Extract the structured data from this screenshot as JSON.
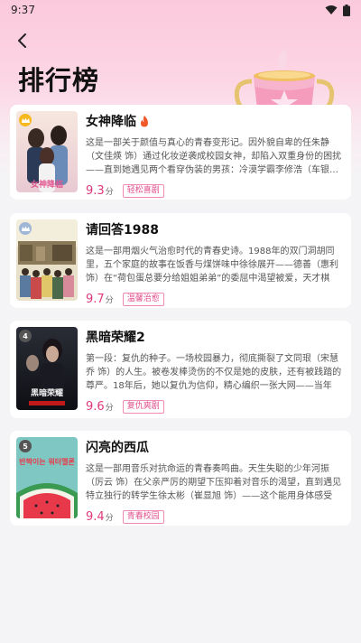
{
  "status_bar": {
    "time": "9:37"
  },
  "header": {
    "title": "排行榜"
  },
  "items": [
    {
      "rank": "1",
      "title": "女神降临",
      "hot": true,
      "description": "这是一部关于颜值与真心的青春变形记。因外貌自卑的任朱静（文佳煐 饰）通过化妆逆袭成校园女神，却陷入双重身份的困扰——直到她遇见两个看穿伪装的男孩：冷漠学霸李修浩（车银…",
      "score": "9.3",
      "score_unit": "分",
      "tag": "轻松喜剧",
      "poster_text": "女神降临"
    },
    {
      "rank": "2",
      "title": "请回答1988",
      "hot": false,
      "description": "这是一部用烟火气治愈时代的青春史诗。1988年的双门洞胡同里，五个家庭的故事在饭香与煤饼味中徐徐展开——德善（惠利 饰）在“荷包蛋总要分给姐姐弟弟”的委屈中渴望被爱，天才棋手…",
      "score": "9.7",
      "score_unit": "分",
      "tag": "温馨治愈",
      "poster_text": ""
    },
    {
      "rank": "4",
      "title": "黑暗荣耀2",
      "hot": false,
      "description": "第一段：复仇的种子。一场校园暴力，彻底撕裂了文同珢（宋慧乔 饰）的人生。被卷发棒烫伤的不仅是她的皮肤，还有被践踏的尊严。18年后，她以复仇为信仰，精心编织一张大网——当年的…",
      "score": "9.6",
      "score_unit": "分",
      "tag": "复仇爽剧",
      "poster_text": "黑暗荣耀"
    },
    {
      "rank": "5",
      "title": "闪亮的西瓜",
      "hot": false,
      "description": "这是一部用音乐对抗命运的青春奏鸣曲。天生失聪的少年河振（厉云 饰）在父亲严厉的期望下压抑着对音乐的渴望，直到遇见特立独行的转学生徐太彬（崔显旭 饰）——这个能用身体感受声…",
      "score": "9.4",
      "score_unit": "分",
      "tag": "青春校园",
      "poster_text": "반짝이는 워터멜론"
    }
  ],
  "colors": {
    "accent": "#e0387c",
    "tag_border": "#f08ab3",
    "header_gradient_top": "#fbc9dc",
    "rank1_badge": "#f5b81f",
    "rank2_badge": "#9fb6d6",
    "rank_other_badge": "#555555"
  },
  "icons": {
    "back": "chevron-left-icon",
    "hot": "fire-icon",
    "wifi": "wifi-icon",
    "battery": "battery-icon",
    "trophy": "trophy-cup-icon",
    "crown": "crown-icon"
  }
}
